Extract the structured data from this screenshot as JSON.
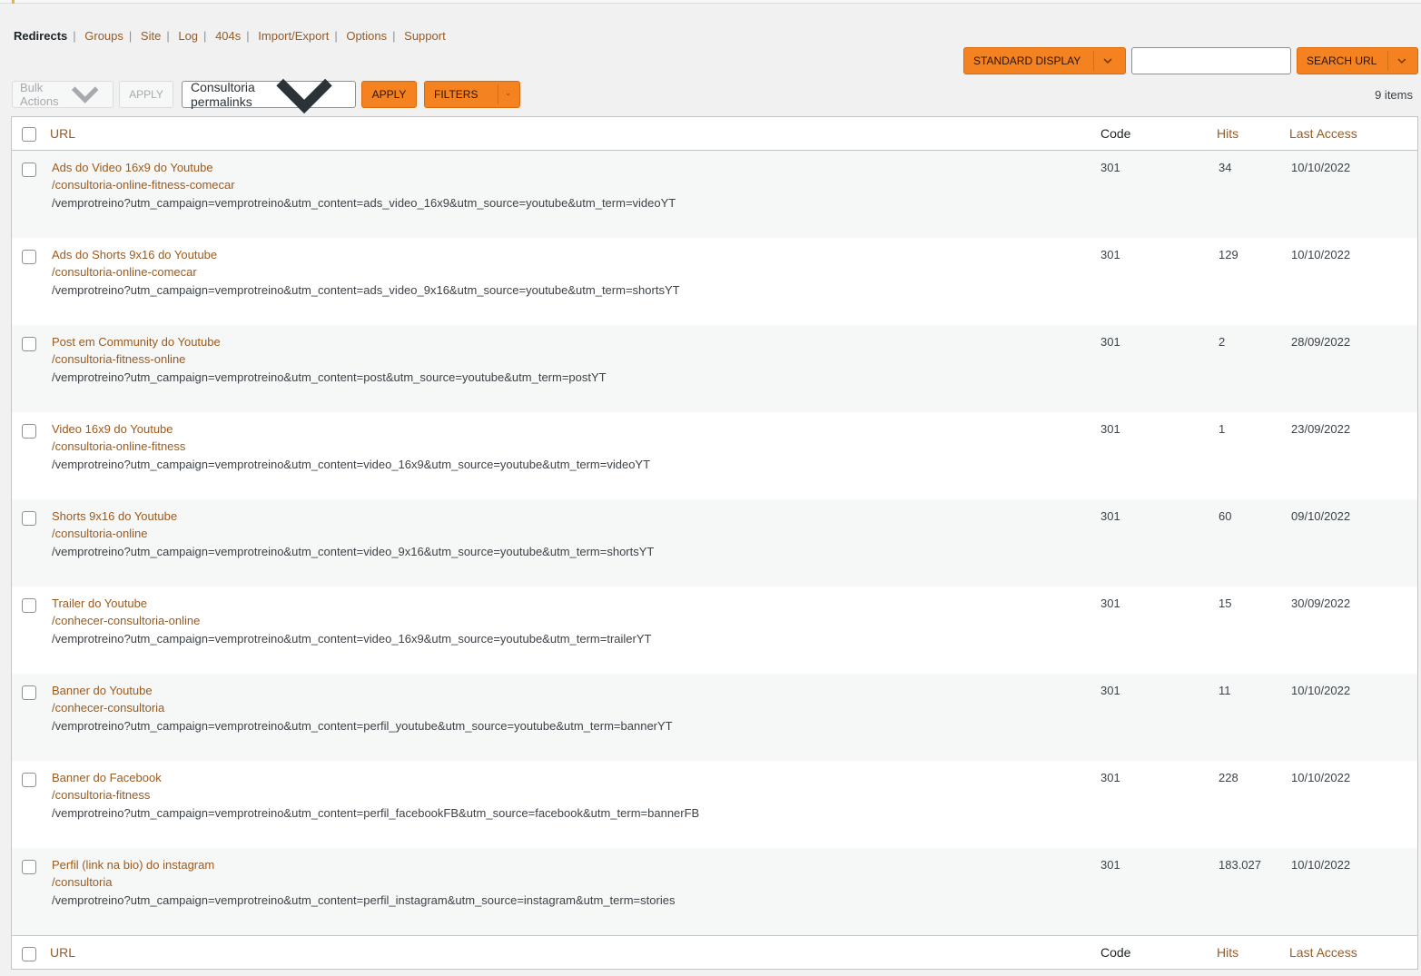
{
  "subnav": [
    {
      "label": "Redirects",
      "current": true
    },
    {
      "label": "Groups"
    },
    {
      "label": "Site"
    },
    {
      "label": "Log"
    },
    {
      "label": "404s"
    },
    {
      "label": "Import/Export"
    },
    {
      "label": "Options"
    },
    {
      "label": "Support"
    }
  ],
  "toolbar": {
    "standard_display": "STANDARD DISPLAY",
    "search_placeholder": "",
    "search_button": "SEARCH URL",
    "bulk_actions": "Bulk Actions",
    "apply_disabled": "APPLY",
    "group_select": "Consultoria permalinks",
    "apply": "APPLY",
    "filters": "FILTERS",
    "items_count": "9 items"
  },
  "columns": {
    "url": "URL",
    "code": "Code",
    "hits": "Hits",
    "last_access": "Last Access"
  },
  "rows": [
    {
      "title": "Ads do Video 16x9 do Youtube",
      "source": "/consultoria-online-fitness-comecar",
      "target": "/vemprotreino?utm_campaign=vemprotreino&utm_content=ads_video_16x9&utm_source=youtube&utm_term=videoYT",
      "code": "301",
      "hits": "34",
      "last": "10/10/2022"
    },
    {
      "title": "Ads do Shorts 9x16 do Youtube",
      "source": "/consultoria-online-comecar",
      "target": "/vemprotreino?utm_campaign=vemprotreino&utm_content=ads_video_9x16&utm_source=youtube&utm_term=shortsYT",
      "code": "301",
      "hits": "129",
      "last": "10/10/2022"
    },
    {
      "title": "Post em Community do Youtube",
      "source": "/consultoria-fitness-online",
      "target": "/vemprotreino?utm_campaign=vemprotreino&utm_content=post&utm_source=youtube&utm_term=postYT",
      "code": "301",
      "hits": "2",
      "last": "28/09/2022"
    },
    {
      "title": "Video 16x9 do Youtube",
      "source": "/consultoria-online-fitness",
      "target": "/vemprotreino?utm_campaign=vemprotreino&utm_content=video_16x9&utm_source=youtube&utm_term=videoYT",
      "code": "301",
      "hits": "1",
      "last": "23/09/2022"
    },
    {
      "title": "Shorts 9x16 do Youtube",
      "source": "/consultoria-online",
      "target": "/vemprotreino?utm_campaign=vemprotreino&utm_content=video_9x16&utm_source=youtube&utm_term=shortsYT",
      "code": "301",
      "hits": "60",
      "last": "09/10/2022"
    },
    {
      "title": "Trailer do Youtube",
      "source": "/conhecer-consultoria-online",
      "target": "/vemprotreino?utm_campaign=vemprotreino&utm_content=video_16x9&utm_source=youtube&utm_term=trailerYT",
      "code": "301",
      "hits": "15",
      "last": "30/09/2022"
    },
    {
      "title": "Banner do Youtube",
      "source": "/conhecer-consultoria",
      "target": "/vemprotreino?utm_campaign=vemprotreino&utm_content=perfil_youtube&utm_source=youtube&utm_term=bannerYT",
      "code": "301",
      "hits": "11",
      "last": "10/10/2022"
    },
    {
      "title": "Banner do Facebook",
      "source": "/consultoria-fitness",
      "target": "/vemprotreino?utm_campaign=vemprotreino&utm_content=perfil_facebookFB&utm_source=facebook&utm_term=bannerFB",
      "code": "301",
      "hits": "228",
      "last": "10/10/2022"
    },
    {
      "title": "Perfil (link na bio) do instagram",
      "source": "/consultoria",
      "target": "/vemprotreino?utm_campaign=vemprotreino&utm_content=perfil_instagram&utm_source=instagram&utm_term=stories",
      "code": "301",
      "hits": "183.027",
      "last": "10/10/2022"
    }
  ],
  "icons": {
    "dropdown": "chevron-down-icon",
    "checkbox": "checkbox"
  },
  "colors": {
    "accent": "#f58220",
    "link": "#9a5b21",
    "top_indicator": "#f0b32e"
  }
}
